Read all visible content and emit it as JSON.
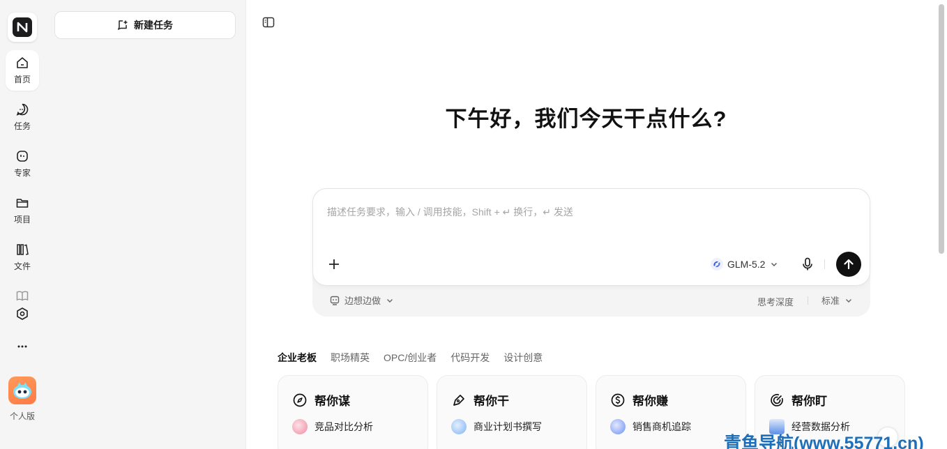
{
  "rail": {
    "items": [
      {
        "label": "首页",
        "icon": "home-icon",
        "active": true
      },
      {
        "label": "任务",
        "icon": "chat-icon"
      },
      {
        "label": "专家",
        "icon": "expert-icon"
      },
      {
        "label": "项目",
        "icon": "folder-icon"
      },
      {
        "label": "文件",
        "icon": "library-icon"
      }
    ],
    "extra_icons": [
      "book-icon",
      "settings-hex-icon",
      "more-icon"
    ],
    "profile_label": "个人版"
  },
  "panel": {
    "new_task_label": "新建任务"
  },
  "main": {
    "greeting": "下午好，我们今天干点什么?",
    "composer": {
      "placeholder": "描述任务要求，输入 / 调用技能，Shift + ↵ 换行，↵ 发送",
      "model": "GLM-5.2",
      "mode_label": "边想边做",
      "depth_label": "思考深度",
      "depth_value": "标准"
    },
    "tabs": [
      {
        "label": "企业老板",
        "active": true
      },
      {
        "label": "职场精英"
      },
      {
        "label": "OPC/创业者"
      },
      {
        "label": "代码开发"
      },
      {
        "label": "设计创意"
      }
    ],
    "cards": [
      {
        "title": "帮你谋",
        "icon": "compass-icon",
        "items": [
          "竞品对比分析"
        ],
        "accent": "#f08aa0"
      },
      {
        "title": "帮你干",
        "icon": "pen-icon",
        "items": [
          "商业计划书撰写"
        ],
        "accent": "#7fb3f0"
      },
      {
        "title": "帮你赚",
        "icon": "dollar-icon",
        "items": [
          "销售商机追踪"
        ],
        "accent": "#6b8ff0"
      },
      {
        "title": "帮你盯",
        "icon": "radar-icon",
        "items": [
          "经营数据分析"
        ],
        "accent": "#5a8ee8"
      }
    ]
  },
  "watermark": "青鱼导航(www.55771.cn)"
}
